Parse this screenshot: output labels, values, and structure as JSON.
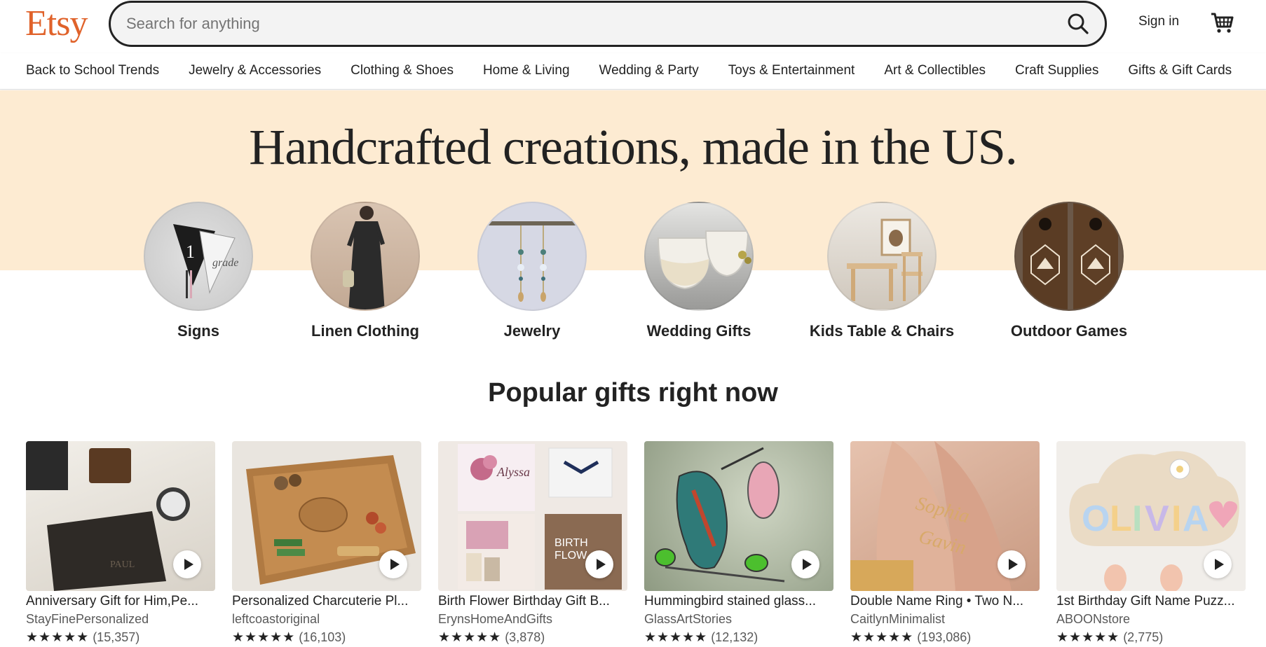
{
  "header": {
    "logo": "Etsy",
    "search_placeholder": "Search for anything",
    "sign_in": "Sign in"
  },
  "nav": {
    "items": [
      "Back to School Trends",
      "Jewelry & Accessories",
      "Clothing & Shoes",
      "Home & Living",
      "Wedding & Party",
      "Toys & Entertainment",
      "Art & Collectibles",
      "Craft Supplies",
      "Gifts & Gift Cards"
    ]
  },
  "hero": {
    "title": "Handcrafted creations, made in the US."
  },
  "categories": [
    {
      "label": "Signs"
    },
    {
      "label": "Linen Clothing"
    },
    {
      "label": "Jewelry"
    },
    {
      "label": "Wedding Gifts"
    },
    {
      "label": "Kids Table & Chairs"
    },
    {
      "label": "Outdoor Games"
    }
  ],
  "popular": {
    "title": "Popular gifts right now",
    "items": [
      {
        "title": "Anniversary Gift for Him,Pe...",
        "shop": "StayFinePersonalized",
        "stars": "★★★★★",
        "reviews": "(15,357)"
      },
      {
        "title": "Personalized Charcuterie Pl...",
        "shop": "leftcoastoriginal",
        "stars": "★★★★★",
        "reviews": "(16,103)"
      },
      {
        "title": "Birth Flower Birthday Gift B...",
        "shop": "ErynsHomeAndGifts",
        "stars": "★★★★★",
        "reviews": "(3,878)"
      },
      {
        "title": "Hummingbird stained glass...",
        "shop": "GlassArtStories",
        "stars": "★★★★★",
        "reviews": "(12,132)"
      },
      {
        "title": "Double Name Ring • Two N...",
        "shop": "CaitlynMinimalist",
        "stars": "★★★★★",
        "reviews": "(193,086)"
      },
      {
        "title": "1st Birthday Gift Name Puzz...",
        "shop": "ABOONstore",
        "stars": "★★★★★",
        "reviews": "(2,775)"
      }
    ]
  },
  "colors": {
    "brand": "#E0622A",
    "hero_bg": "#FDEBD2",
    "text": "#222222"
  }
}
